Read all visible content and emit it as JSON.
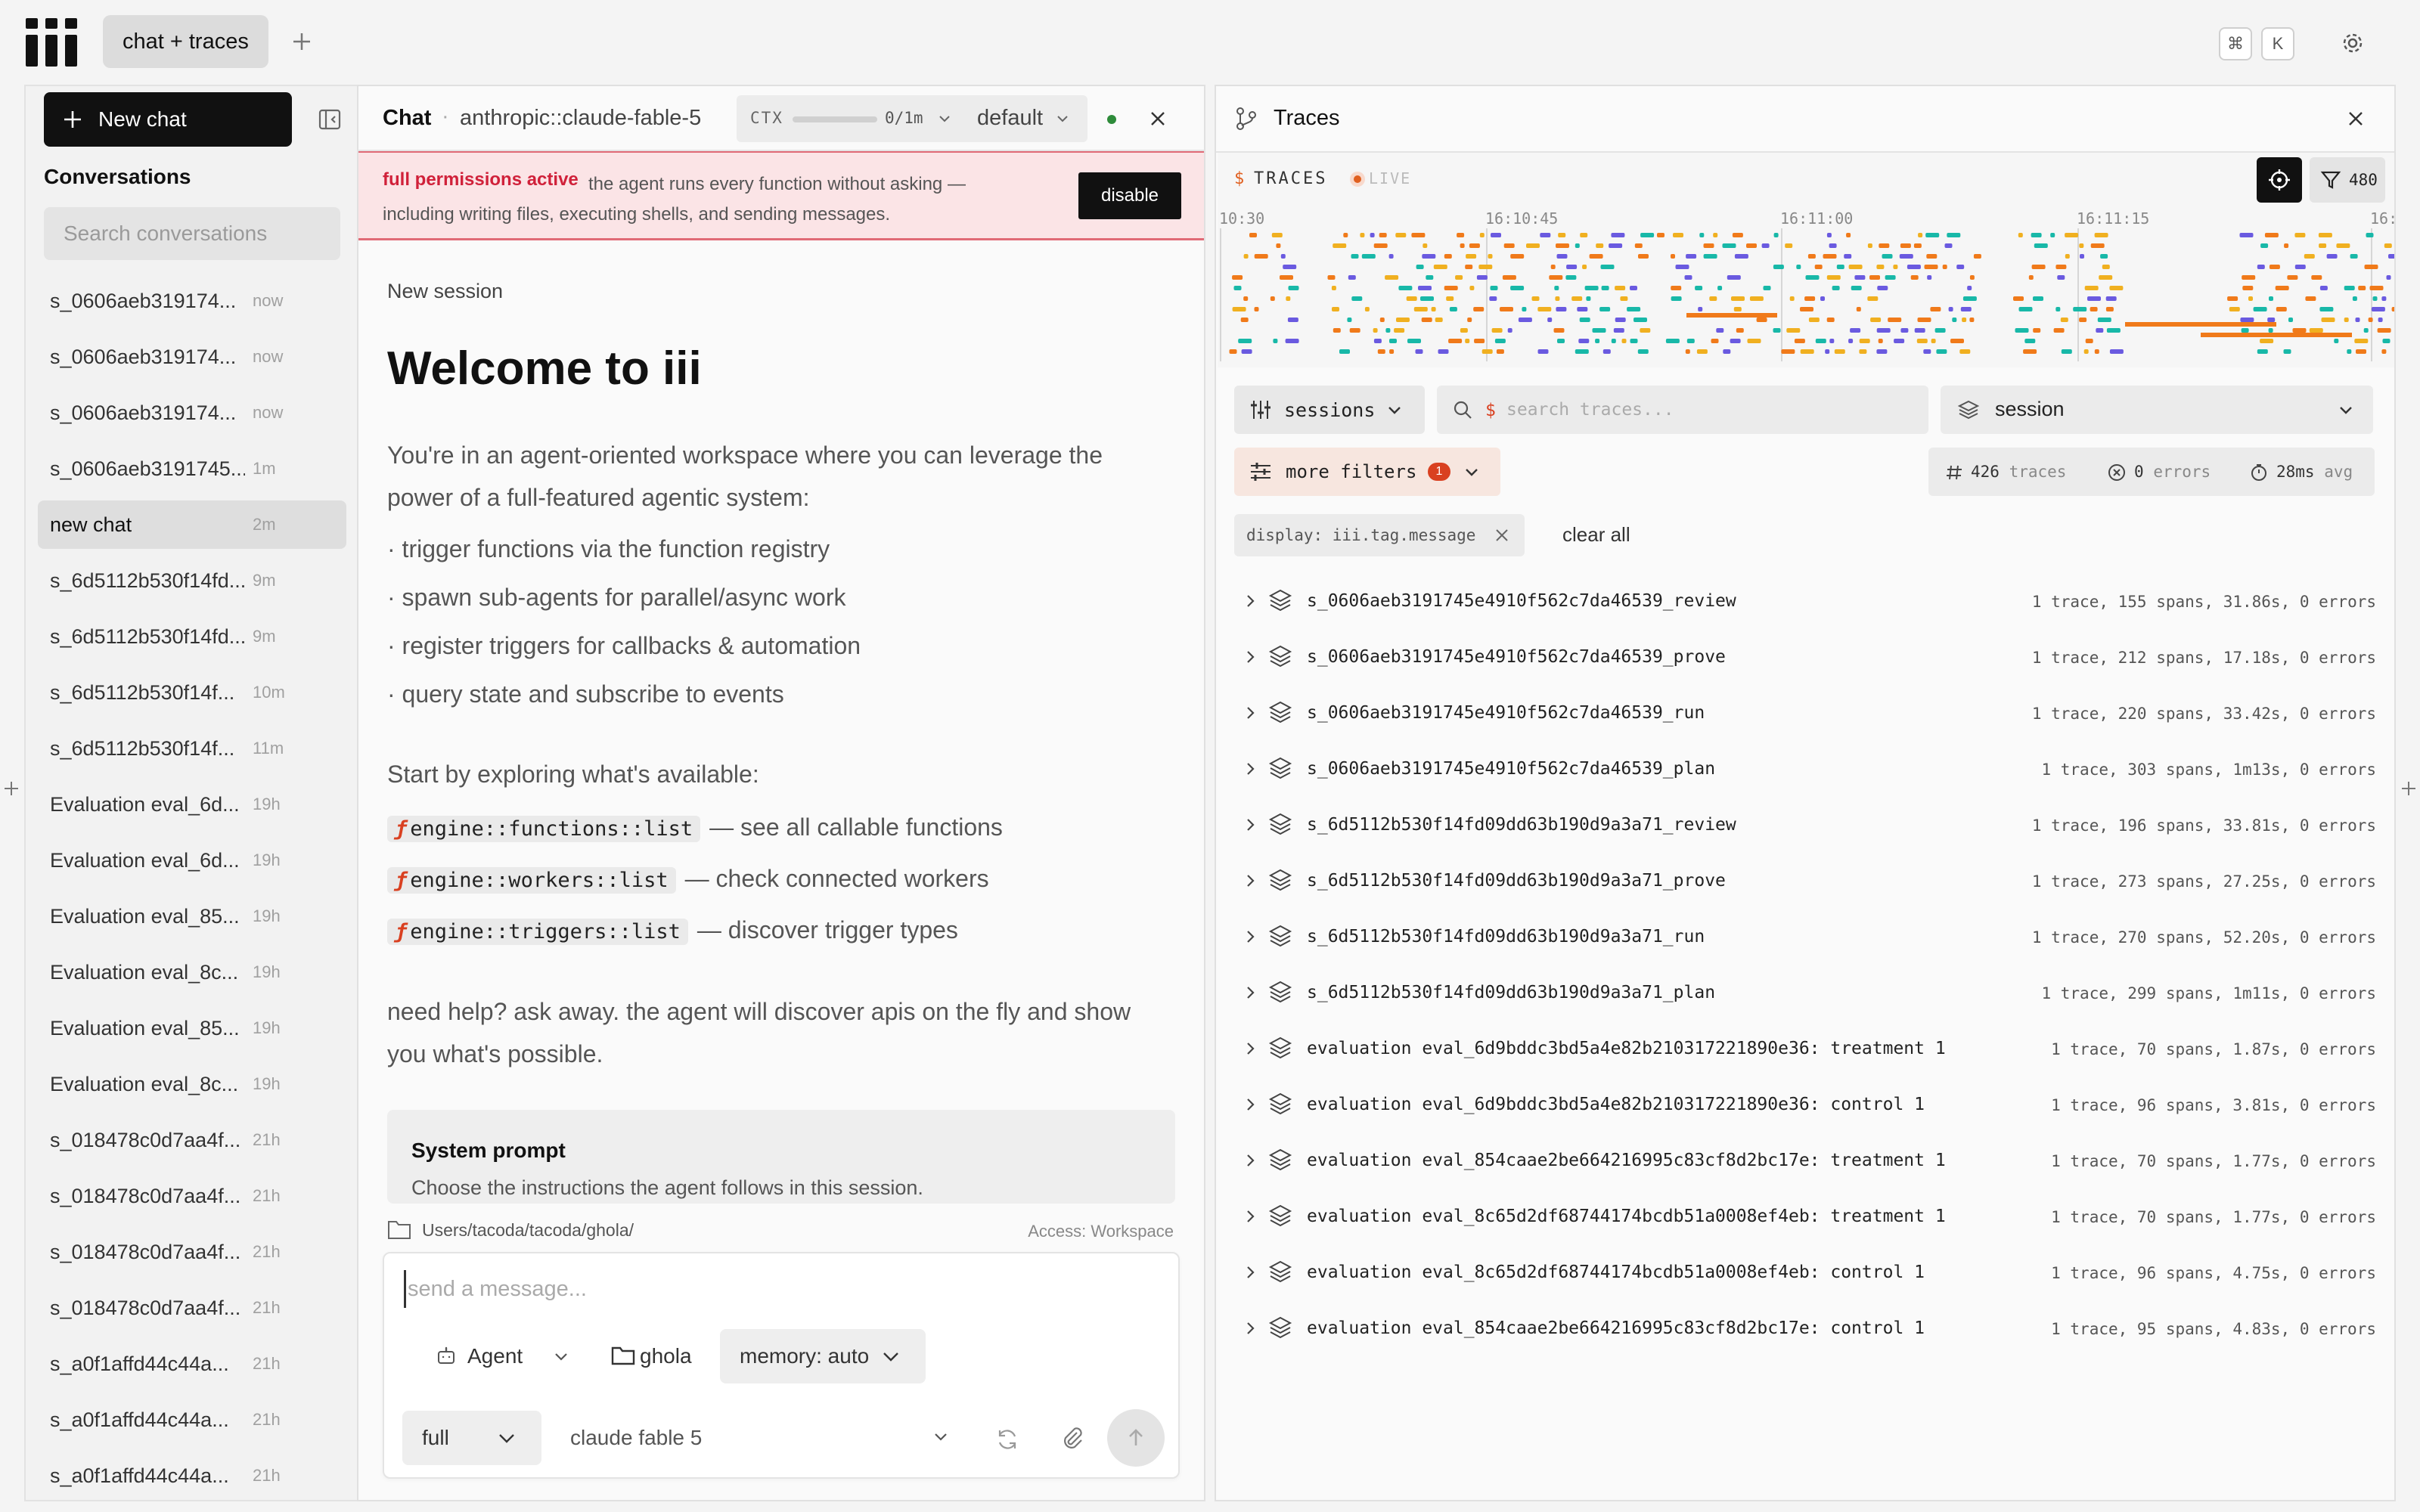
{
  "tabs": {
    "active": "chat + traces",
    "add_icon": "plus-icon"
  },
  "shortcut": {
    "mod": "⌘",
    "key": "K"
  },
  "sidebar": {
    "new_chat": "New chat",
    "conversations_title": "Conversations",
    "search_placeholder": "Search conversations",
    "items": [
      {
        "label": "s_0606aeb319174...",
        "time": "now"
      },
      {
        "label": "s_0606aeb319174...",
        "time": "now"
      },
      {
        "label": "s_0606aeb319174...",
        "time": "now"
      },
      {
        "label": "s_0606aeb3191745...",
        "time": "1m"
      },
      {
        "label": "new chat",
        "time": "2m"
      },
      {
        "label": "s_6d5112b530f14fd...",
        "time": "9m"
      },
      {
        "label": "s_6d5112b530f14fd...",
        "time": "9m"
      },
      {
        "label": "s_6d5112b530f14f...",
        "time": "10m"
      },
      {
        "label": "s_6d5112b530f14f...",
        "time": "11m"
      },
      {
        "label": "Evaluation eval_6d...",
        "time": "19h"
      },
      {
        "label": "Evaluation eval_6d...",
        "time": "19h"
      },
      {
        "label": "Evaluation eval_85...",
        "time": "19h"
      },
      {
        "label": "Evaluation eval_8c...",
        "time": "19h"
      },
      {
        "label": "Evaluation eval_85...",
        "time": "19h"
      },
      {
        "label": "Evaluation eval_8c...",
        "time": "19h"
      },
      {
        "label": "s_018478c0d7aa4f...",
        "time": "21h"
      },
      {
        "label": "s_018478c0d7aa4f...",
        "time": "21h"
      },
      {
        "label": "s_018478c0d7aa4f...",
        "time": "21h"
      },
      {
        "label": "s_018478c0d7aa4f...",
        "time": "21h"
      },
      {
        "label": "s_a0f1affd44c44a...",
        "time": "21h"
      },
      {
        "label": "s_a0f1affd44c44a...",
        "time": "21h"
      },
      {
        "label": "s_a0f1affd44c44a...",
        "time": "21h"
      }
    ],
    "active_index": 4
  },
  "chat": {
    "title": "Chat",
    "separator": "·",
    "model": "anthropic::claude-fable-5",
    "ctx_label": "CTX",
    "ctx_value": "0/1m",
    "ctx_fraction": 0,
    "profile": "default",
    "banner_strong": "full permissions active",
    "banner_text": "the agent runs every function without asking — including writing files, executing shells, and sending messages.",
    "disable": "disable",
    "new_session": "New session",
    "welcome": "Welcome to iii",
    "intro": "You're in an agent-oriented workspace where you can leverage the power of a full-featured agentic system:",
    "bullets": [
      "· trigger functions via the function registry",
      "· spawn sub-agents for parallel/async work",
      "· register triggers for callbacks & automation",
      "· query state and subscribe to events"
    ],
    "explore": "Start by exploring what's available:",
    "commands": [
      {
        "fn": "ƒ",
        "name": "engine::functions::list",
        "desc": "— see all callable functions"
      },
      {
        "fn": "ƒ",
        "name": "engine::workers::list",
        "desc": "— check connected workers"
      },
      {
        "fn": "ƒ",
        "name": "engine::triggers::list",
        "desc": "— discover trigger types"
      }
    ],
    "help": "need help? ask away. the agent will discover apis on the fly and show you what's possible.",
    "system_prompt_title": "System prompt",
    "system_prompt_desc": "Choose the instructions the agent follows in this session.",
    "path": "Users/tacoda/tacoda/ghola/",
    "access": "Access: Workspace",
    "input_placeholder": "send a message...",
    "agent": "Agent",
    "folder": "ghola",
    "memory": "memory: auto",
    "mode": "full",
    "model_select": "claude fable 5"
  },
  "traces": {
    "title": "Traces",
    "timeline_dollar": "$",
    "timeline_label": "TRACES",
    "live": "LIVE",
    "filter_count": "480",
    "time_ticks": [
      "10:30",
      "16:10:45",
      "16:11:00",
      "16:11:15",
      "16:"
    ],
    "group_by": "sessions",
    "search_dollar": "$",
    "search_placeholder": "search traces...",
    "group_select": "session",
    "more_filters": "more filters",
    "more_filters_count": "1",
    "stats": {
      "traces_count": "426",
      "traces_label": "traces",
      "errors_count": "0",
      "errors_label": "errors",
      "avg": "28ms",
      "avg_label": "avg"
    },
    "display_filter": "display: iii.tag.message",
    "clear_all": "clear all",
    "rows": [
      {
        "name": "s_0606aeb3191745e4910f562c7da46539_review",
        "meta": "1 trace, 155 spans, 31.86s, 0 errors"
      },
      {
        "name": "s_0606aeb3191745e4910f562c7da46539_prove",
        "meta": "1 trace, 212 spans, 17.18s, 0 errors"
      },
      {
        "name": "s_0606aeb3191745e4910f562c7da46539_run",
        "meta": "1 trace, 220 spans, 33.42s, 0 errors"
      },
      {
        "name": "s_0606aeb3191745e4910f562c7da46539_plan",
        "meta": "1 trace, 303 spans, 1m13s, 0 errors"
      },
      {
        "name": "s_6d5112b530f14fd09dd63b190d9a3a71_review",
        "meta": "1 trace, 196 spans, 33.81s, 0 errors"
      },
      {
        "name": "s_6d5112b530f14fd09dd63b190d9a3a71_prove",
        "meta": "1 trace, 273 spans, 27.25s, 0 errors"
      },
      {
        "name": "s_6d5112b530f14fd09dd63b190d9a3a71_run",
        "meta": "1 trace, 270 spans, 52.20s, 0 errors"
      },
      {
        "name": "s_6d5112b530f14fd09dd63b190d9a3a71_plan",
        "meta": "1 trace, 299 spans, 1m11s, 0 errors"
      },
      {
        "name": "evaluation eval_6d9bddc3bd5a4e82b210317221890e36: treatment 1",
        "meta": "1 trace, 70 spans, 1.87s, 0 errors"
      },
      {
        "name": "evaluation eval_6d9bddc3bd5a4e82b210317221890e36: control 1",
        "meta": "1 trace, 96 spans, 3.81s, 0 errors"
      },
      {
        "name": "evaluation eval_854caae2be664216995c83cf8d2bc17e: treatment 1",
        "meta": "1 trace, 70 spans, 1.77s, 0 errors"
      },
      {
        "name": "evaluation eval_8c65d2df68744174bcdb51a0008ef4eb: treatment 1",
        "meta": "1 trace, 70 spans, 1.77s, 0 errors"
      },
      {
        "name": "evaluation eval_8c65d2df68744174bcdb51a0008ef4eb: control 1",
        "meta": "1 trace, 96 spans, 4.75s, 0 errors"
      },
      {
        "name": "evaluation eval_854caae2be664216995c83cf8d2bc17e: control 1",
        "meta": "1 trace, 95 spans, 4.83s, 0 errors"
      }
    ]
  },
  "colors": {
    "accent": "#d94020",
    "banner_bg": "#fbe4e6",
    "banner_text": "#d0213a",
    "status_ok": "#2e8b3a",
    "span_orange": "#f07a1a",
    "span_yellow": "#f0b020",
    "span_teal": "#18b8a8",
    "span_purple": "#6a5ae0"
  }
}
